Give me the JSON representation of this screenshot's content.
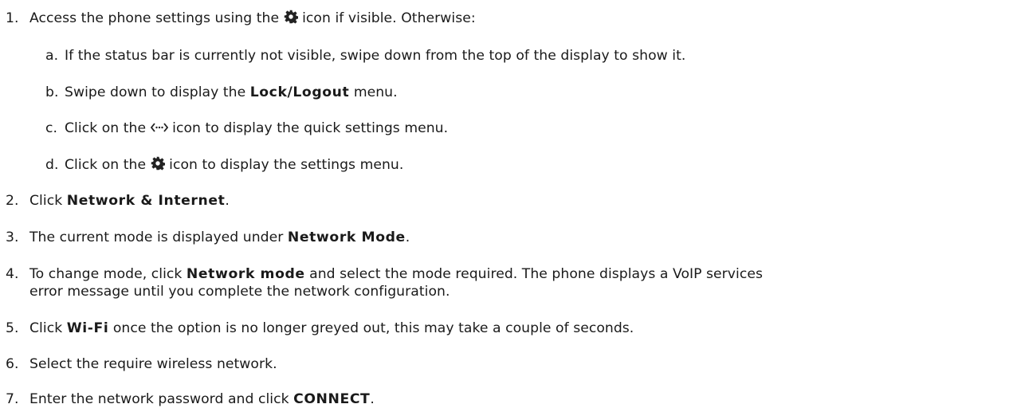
{
  "steps": [
    {
      "num": "1.",
      "pre": "Access the phone settings using the ",
      "icon": "gear-icon",
      "post": " icon if visible. Otherwise:"
    },
    {
      "num": "2.",
      "pre": "Click ",
      "bold": "Network & Internet",
      "post": "."
    },
    {
      "num": "3.",
      "pre": "The current mode is displayed under ",
      "bold": "Network Mode",
      "post": "."
    },
    {
      "num": "4.",
      "pre": "To change mode, click ",
      "bold": "Network mode",
      "post": " and select the mode required. The phone displays a VoIP services",
      "cont": "error message until you complete the network configuration."
    },
    {
      "num": "5.",
      "pre": "Click ",
      "bold": "Wi-Fi",
      "post": " once the option is no longer greyed out, this may take a couple of seconds."
    },
    {
      "num": "6.",
      "pre": "Select the require wireless network."
    },
    {
      "num": "7.",
      "pre": "Enter the network password and click ",
      "bold": "CONNECT",
      "post": "."
    }
  ],
  "substeps": [
    {
      "num": "a.",
      "pre": "If the status bar is currently not visible, swipe down from the top of the display to show it."
    },
    {
      "num": "b.",
      "pre": "Swipe down to display the ",
      "bold": "Lock/Logout",
      "post": " menu."
    },
    {
      "num": "c.",
      "pre": "Click on the ",
      "icon": "quick-settings-icon",
      "post": " icon to display the quick settings menu."
    },
    {
      "num": "d.",
      "pre": "Click on the ",
      "icon": "gear-icon",
      "post": " icon to display the settings menu."
    }
  ]
}
